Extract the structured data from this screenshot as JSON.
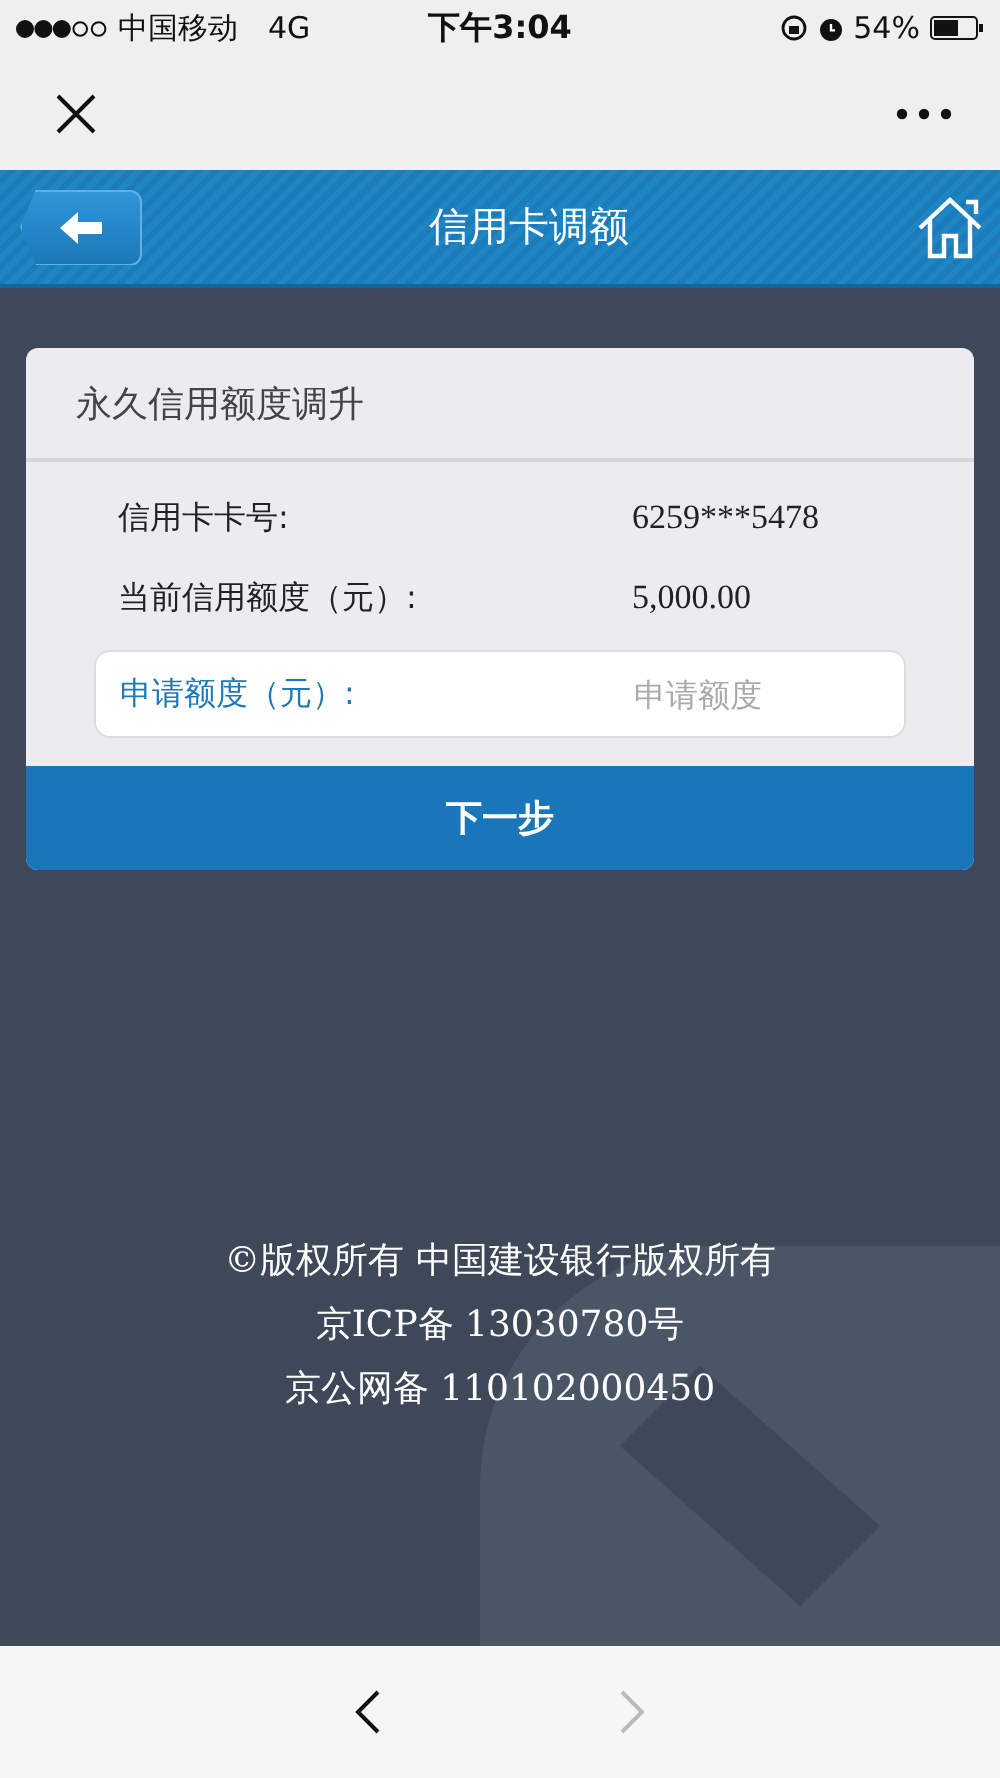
{
  "status_bar": {
    "carrier": "中国移动",
    "network": "4G",
    "time": "下午3:04",
    "battery": "54%"
  },
  "header": {
    "title": "信用卡调额"
  },
  "card": {
    "title": "永久信用额度调升",
    "rows": [
      {
        "label": "信用卡卡号:",
        "value": "6259***5478"
      },
      {
        "label": "当前信用额度（元）:",
        "value": "5,000.00"
      }
    ],
    "field": {
      "label": "申请额度（元）:",
      "placeholder": "申请额度"
    },
    "button": "下一步"
  },
  "footer": [
    "©版权所有 中国建设银行版权所有",
    "京ICP备 13030780号",
    "京公网备 110102000450"
  ],
  "bottom_nav": [
    {
      "kind": "back",
      "disabled": false
    },
    {
      "kind": "forward",
      "disabled": true
    }
  ]
}
